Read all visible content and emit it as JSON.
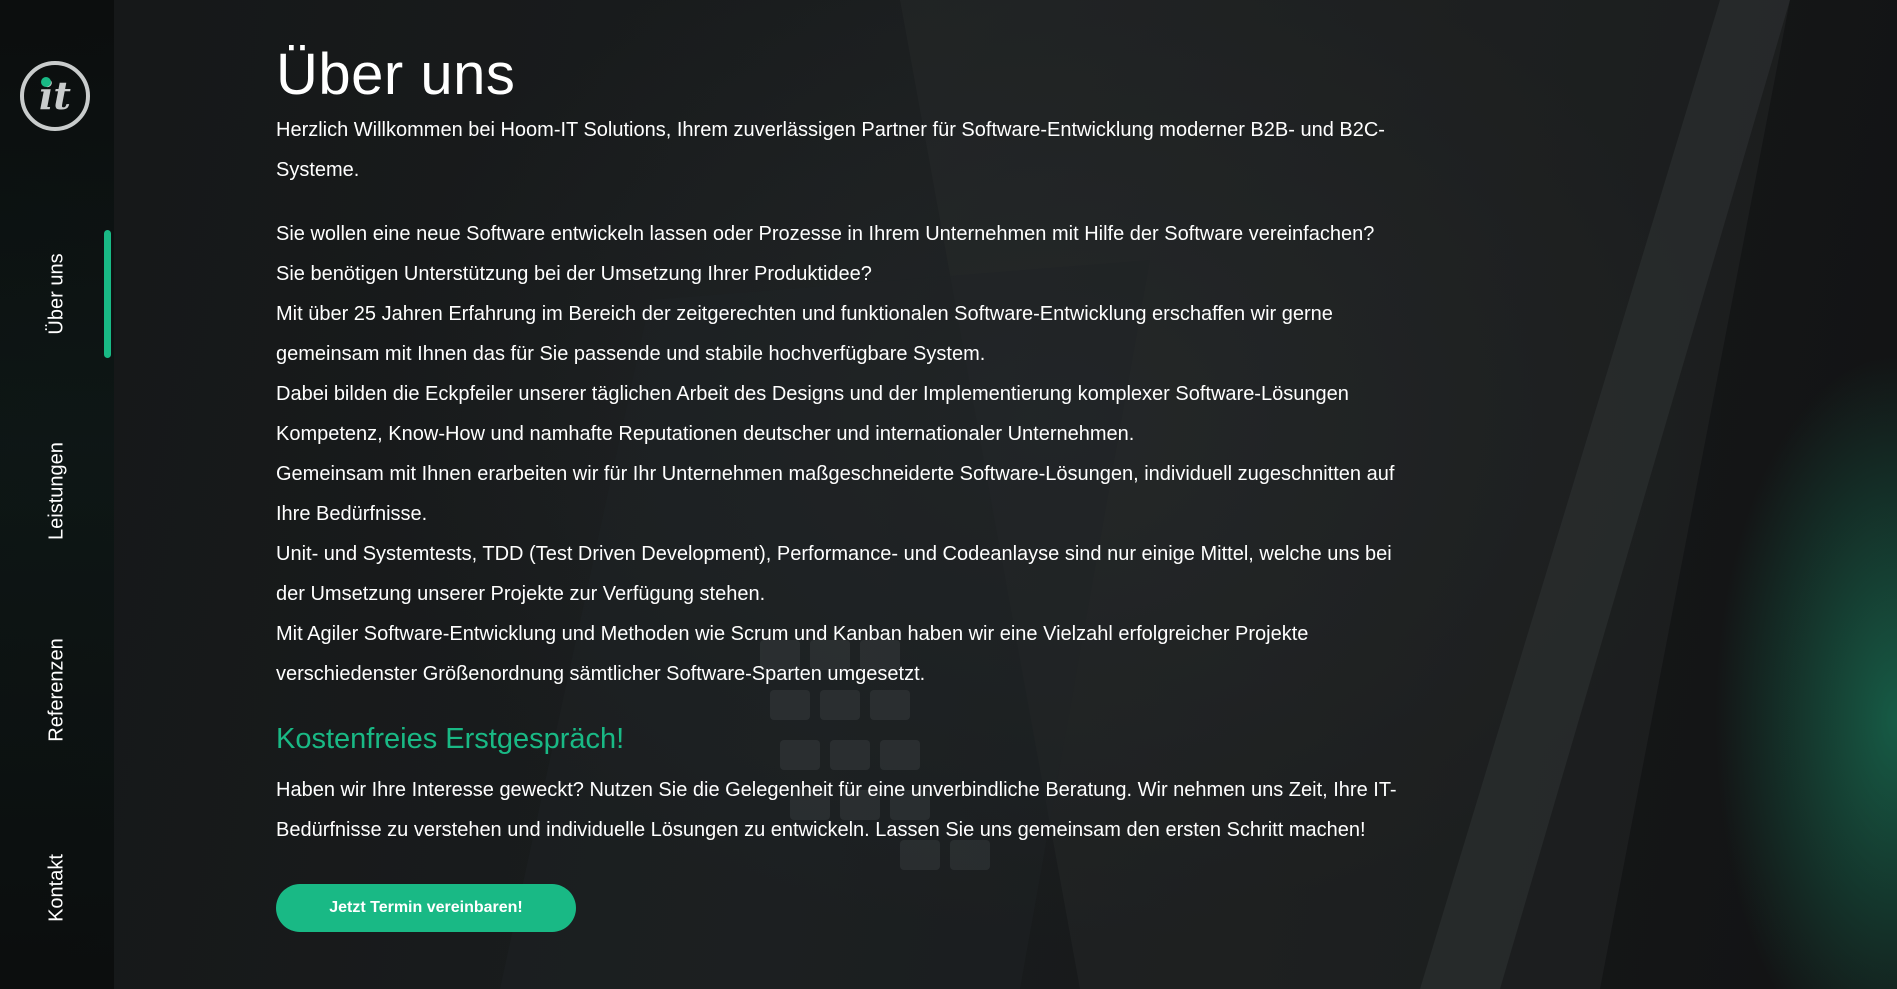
{
  "brand": {
    "logo_text": "it",
    "accent_color": "#19b985"
  },
  "nav": {
    "items": [
      {
        "label": "Über uns",
        "active": true
      },
      {
        "label": "Leistungen",
        "active": false
      },
      {
        "label": "Referenzen",
        "active": false
      },
      {
        "label": "Kontakt",
        "active": false
      }
    ]
  },
  "main": {
    "title": "Über uns",
    "intro": "Herzlich Willkommen bei Hoom-IT Solutions, Ihrem zuverlässigen Partner für Software-Entwicklung moderner B2B- und B2C-Systeme.",
    "paragraphs": [
      "Sie wollen eine neue Software entwickeln lassen oder Prozesse in Ihrem Unternehmen mit Hilfe der Software vereinfachen?",
      "Sie benötigen Unterstützung bei der Umsetzung Ihrer Produktidee?",
      "Mit über 25 Jahren Erfahrung im Bereich der zeitgerechten und funktionalen Software-Entwicklung erschaffen wir gerne gemeinsam mit Ihnen das für Sie passende und stabile hochverfügbare System.",
      "Dabei bilden die Eckpfeiler unserer täglichen Arbeit des Designs und der Implementierung komplexer Software-Lösungen Kompetenz, Know-How und namhafte Reputationen deutscher und internationaler Unternehmen.",
      "Gemeinsam mit Ihnen erarbeiten wir für Ihr Unternehmen maßgeschneiderte Software-Lösungen, individuell zugeschnitten auf Ihre Bedürfnisse.",
      "Unit- und Systemtests, TDD (Test Driven Development), Performance- und Codeanlayse sind nur einige Mittel, welche uns bei der Umsetzung unserer Projekte zur Verfügung stehen.",
      "Mit Agiler Software-Entwicklung und Methoden wie Scrum und Kanban haben wir eine Vielzahl erfolgreicher Projekte verschiedenster Größenordnung sämtlicher Software-Sparten umgesetzt."
    ],
    "subheading": "Kostenfreies Erstgespräch!",
    "cta_text": "Haben wir Ihre Interesse geweckt? Nutzen Sie die Gelegenheit für eine unverbindliche Beratung. Wir nehmen uns Zeit, Ihre IT-Bedürfnisse zu verstehen und individuelle Lösungen zu entwickeln. Lassen Sie uns gemeinsam den ersten Schritt machen!",
    "cta_button": "Jetzt Termin vereinbaren!"
  }
}
